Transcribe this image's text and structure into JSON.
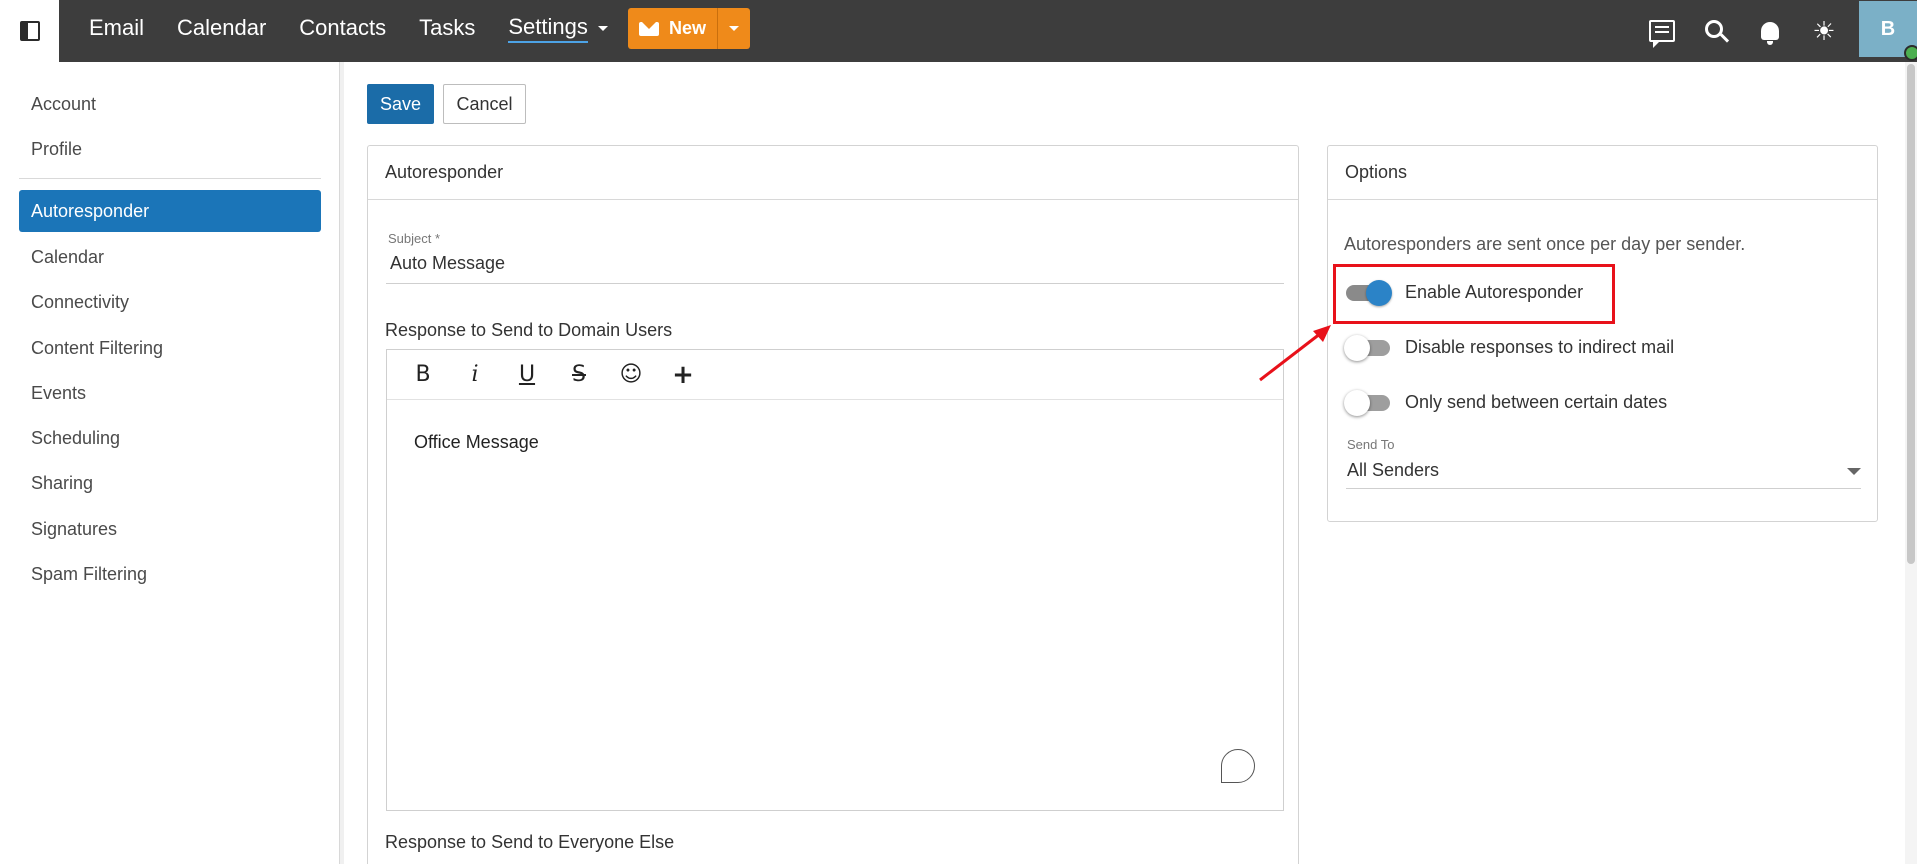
{
  "topbar": {
    "nav": [
      "Email",
      "Calendar",
      "Contacts",
      "Tasks"
    ],
    "active_nav": "Settings",
    "new_label": "New",
    "avatar_initial": "B"
  },
  "sidebar": {
    "items_top": [
      "Account",
      "Profile"
    ],
    "selected": "Autoresponder",
    "items": [
      "Calendar",
      "Connectivity",
      "Content Filtering",
      "Events",
      "Scheduling",
      "Sharing",
      "Signatures",
      "Spam Filtering"
    ]
  },
  "actions": {
    "save": "Save",
    "cancel": "Cancel"
  },
  "autoresponder": {
    "title": "Autoresponder",
    "subject_label": "Subject *",
    "subject_value": "Auto Message",
    "domain_users_label": "Response to Send to Domain Users",
    "editor_toolbar": {
      "bold": "B",
      "italic": "i",
      "underline": "U",
      "strike": "S",
      "emoji": "☺",
      "plus": "+"
    },
    "domain_users_body": "Office Message",
    "everyone_else_label": "Response to Send to Everyone Else"
  },
  "options": {
    "title": "Options",
    "note": "Autoresponders are sent once per day per sender.",
    "toggles": [
      {
        "label": "Enable Autoresponder",
        "on": true
      },
      {
        "label": "Disable responses to indirect mail",
        "on": false
      },
      {
        "label": "Only send between certain dates",
        "on": false
      }
    ],
    "send_to_label": "Send To",
    "send_to_value": "All Senders"
  },
  "colors": {
    "topbar": "#3d3d3d",
    "accent": "#1b75b8",
    "new_button": "#ef8a1a",
    "highlight": "#e8111a"
  }
}
